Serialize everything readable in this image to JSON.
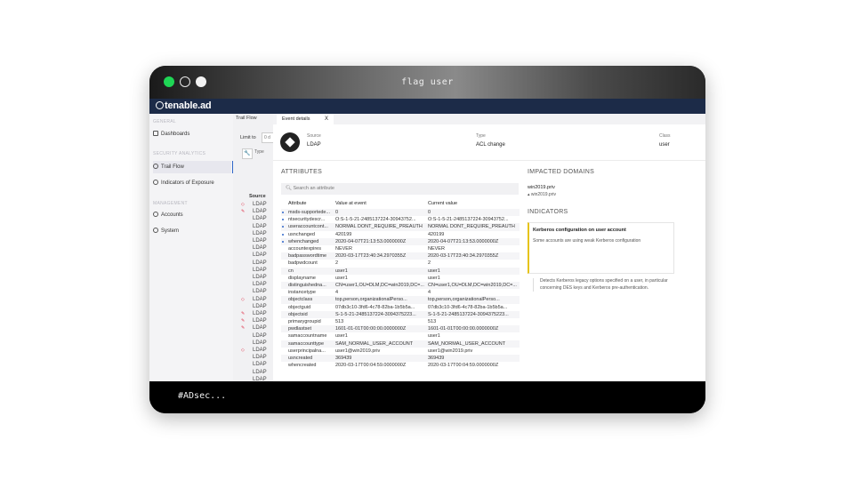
{
  "window": {
    "title": "flag user"
  },
  "app": {
    "logo": "tenable.ad"
  },
  "sidebar": {
    "sections": [
      {
        "label": "GENERAL",
        "items": [
          {
            "label": "Dashboards",
            "icon": "dashboard-icon"
          }
        ]
      },
      {
        "label": "SECURITY ANALYTICS",
        "items": [
          {
            "label": "Trail Flow",
            "icon": "trail-flow-icon"
          },
          {
            "label": "Indicators of Exposure",
            "icon": "ioe-icon"
          }
        ]
      },
      {
        "label": "MANAGEMENT",
        "items": [
          {
            "label": "Accounts",
            "icon": "accounts-icon"
          },
          {
            "label": "System",
            "icon": "gear-icon"
          }
        ]
      }
    ]
  },
  "trailflow": {
    "tab": "Trail Flow",
    "limit_label": "Limit to",
    "limit_value": "0 d",
    "type_label": "Type",
    "source_header": "Source",
    "rows": [
      "LDAP",
      "LDAP",
      "LDAP",
      "LDAP",
      "LDAP",
      "LDAP",
      "LDAP",
      "LDAP",
      "LDAP",
      "LDAP",
      "LDAP",
      "LDAP",
      "LDAP",
      "LDAP",
      "LDAP",
      "LDAP",
      "LDAP",
      "LDAP",
      "LDAP",
      "LDAP",
      "LDAP",
      "LDAP",
      "LDAP",
      "LDAP",
      "LDAP",
      "LDAP"
    ]
  },
  "details": {
    "tab_label": "Event details",
    "tab_close": "X",
    "header": {
      "source_label": "Source",
      "source_value": "LDAP",
      "type_label": "Type",
      "type_value": "ACL change",
      "class_label": "Class",
      "class_value": "user"
    },
    "attributes_heading": "ATTRIBUTES",
    "search_placeholder": "Search an attribute",
    "columns": [
      "Attribute",
      "Value at event",
      "Current value"
    ],
    "rows": [
      {
        "attr": "msds-supportede...",
        "event": "0",
        "current": "0",
        "changed": true
      },
      {
        "attr": "ntsecuritydescr...",
        "event": "O:S-1-5-21-2485137224-30943752...",
        "current": "O:S-1-5-21-2485137224-30943752...",
        "changed": true
      },
      {
        "attr": "useraccountcont...",
        "event": "NORMAL DONT_REQUIRE_PREAUTH",
        "current": "NORMAL DONT_REQUIRE_PREAUTH",
        "changed": true
      },
      {
        "attr": "usnchanged",
        "event": "420199",
        "current": "420199",
        "changed": true
      },
      {
        "attr": "whenchanged",
        "event": "2020-04-07T21:13:53.0000000Z",
        "current": "2020-04-07T21:13:53.0000000Z",
        "changed": true
      },
      {
        "attr": "accountexpires",
        "event": "NEVER",
        "current": "NEVER",
        "changed": false
      },
      {
        "attr": "badpasswordtime",
        "event": "2020-03-17T23:40:34.2970355Z",
        "current": "2020-03-17T23:40:34.2970355Z",
        "changed": false
      },
      {
        "attr": "badpwdcount",
        "event": "2",
        "current": "2",
        "changed": false
      },
      {
        "attr": "cn",
        "event": "user1",
        "current": "user1",
        "changed": false
      },
      {
        "attr": "displayname",
        "event": "user1",
        "current": "user1",
        "changed": false
      },
      {
        "attr": "distinguishedna...",
        "event": "CN=user1,OU=DLM,DC=win2019,DC=...",
        "current": "CN=user1,OU=DLM,DC=win2019,DC=...",
        "changed": false
      },
      {
        "attr": "instancetype",
        "event": "4",
        "current": "4",
        "changed": false
      },
      {
        "attr": "objectclass",
        "event": "top,person,organizationalPerso...",
        "current": "top,person,organizationalPerso...",
        "changed": false
      },
      {
        "attr": "objectguid",
        "event": "07db3c10-3fd6-4c78-82ba-1b5b5a...",
        "current": "07db3c10-3fd6-4c78-82ba-1b5b5a...",
        "changed": false
      },
      {
        "attr": "objectsid",
        "event": "S-1-5-21-2485137224-3094375223...",
        "current": "S-1-5-21-2485137224-3094375223...",
        "changed": false
      },
      {
        "attr": "primarygroupid",
        "event": "513",
        "current": "513",
        "changed": false
      },
      {
        "attr": "pwdlastset",
        "event": "1601-01-01T00:00:00.0000000Z",
        "current": "1601-01-01T00:00:00.0000000Z",
        "changed": false
      },
      {
        "attr": "samaccountname",
        "event": "user1",
        "current": "user1",
        "changed": false
      },
      {
        "attr": "samaccounttype",
        "event": "SAM_NORMAL_USER_ACCOUNT",
        "current": "SAM_NORMAL_USER_ACCOUNT",
        "changed": false
      },
      {
        "attr": "userprincipalna...",
        "event": "user1@win2019.priv",
        "current": "user1@win2019.priv",
        "changed": false
      },
      {
        "attr": "usncreated",
        "event": "369439",
        "current": "369439",
        "changed": false
      },
      {
        "attr": "whencreated",
        "event": "2020-03-17T00:04:59.0000000Z",
        "current": "2020-03-17T00:04:59.0000000Z",
        "changed": false
      }
    ],
    "impacted_heading": "IMPACTED DOMAINS",
    "domain_name": "win2019.priv",
    "domain_sub": "▴ win2019.priv",
    "indicators_heading": "INDICATORS",
    "indicator_title": "Kerberos configuration on user account",
    "indicator_subtitle": "Some accounts are using weak Kerberos configuration",
    "indicator_description": "Detects Kerberos legacy options specified on a user, in particular concerning DES keys and Kerberos pre-authentication."
  },
  "terminal": {
    "prompt": "#ADsec..."
  },
  "colors": {
    "nav": "#1c2b48",
    "accent": "#2f66c9",
    "indicator": "#e6c317",
    "alert": "#e0334a"
  }
}
